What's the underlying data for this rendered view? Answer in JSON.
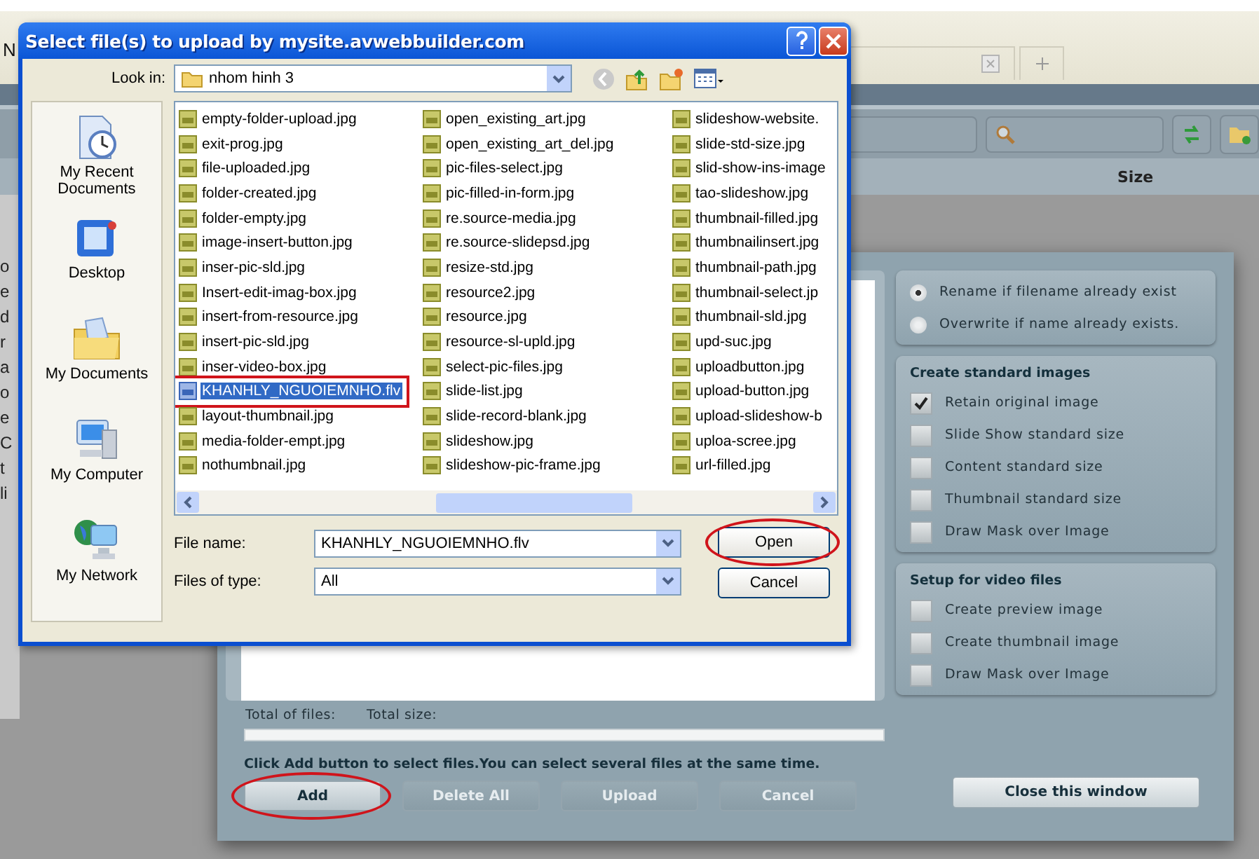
{
  "browser": {
    "fragment": "N"
  },
  "background_app": {
    "left_fragments": [
      "o",
      "e",
      "d",
      "r",
      "a",
      "o",
      "e",
      "C",
      "t",
      "li"
    ],
    "column_header": "Size"
  },
  "upload_panel": {
    "totals": [
      "Total of files:",
      "Total size:"
    ],
    "hint": "Click Add button to select files.You can select several files at the same time.",
    "buttons": [
      {
        "label": "Add",
        "disabled": false,
        "highlighted": true
      },
      {
        "label": "Delete All",
        "disabled": true,
        "highlighted": false
      },
      {
        "label": "Upload",
        "disabled": true,
        "highlighted": false
      },
      {
        "label": "Cancel",
        "disabled": true,
        "highlighted": false
      }
    ],
    "conflict_options": [
      {
        "label": "Rename if filename already exist",
        "selected": true
      },
      {
        "label": "Overwrite if name already exists.",
        "selected": false
      }
    ],
    "groups": [
      {
        "title": "Create standard images",
        "options": [
          {
            "label": "Retain original image",
            "checked": true
          },
          {
            "label": "Slide Show standard size",
            "checked": false
          },
          {
            "label": "Content standard size",
            "checked": false
          },
          {
            "label": "Thumbnail standard size",
            "checked": false
          },
          {
            "label": "Draw Mask over Image",
            "checked": false
          }
        ]
      },
      {
        "title": "Setup for video files",
        "options": [
          {
            "label": "Create preview image",
            "checked": false
          },
          {
            "label": "Create thumbnail image",
            "checked": false
          },
          {
            "label": "Draw Mask over Image",
            "checked": false
          }
        ]
      }
    ],
    "close_button": "Close this window"
  },
  "file_dialog": {
    "title": "Select file(s) to upload by mysite.avwebbuilder.com",
    "look_in_label": "Look in:",
    "folder": "nhom hinh 3",
    "places": [
      {
        "label": "My Recent Documents",
        "kind": "recent"
      },
      {
        "label": "Desktop",
        "kind": "desktop"
      },
      {
        "label": "My Documents",
        "kind": "documents"
      },
      {
        "label": "My Computer",
        "kind": "computer"
      },
      {
        "label": "My Network",
        "kind": "network"
      }
    ],
    "files": [
      {
        "name": "empty-folder-upload.jpg",
        "kind": "jpg",
        "selected": false
      },
      {
        "name": "exit-prog.jpg",
        "kind": "jpg",
        "selected": false
      },
      {
        "name": "file-uploaded.jpg",
        "kind": "jpg",
        "selected": false
      },
      {
        "name": "folder-created.jpg",
        "kind": "jpg",
        "selected": false
      },
      {
        "name": "folder-empty.jpg",
        "kind": "jpg",
        "selected": false
      },
      {
        "name": "image-insert-button.jpg",
        "kind": "jpg",
        "selected": false
      },
      {
        "name": "inser-pic-sld.jpg",
        "kind": "jpg",
        "selected": false
      },
      {
        "name": "Insert-edit-imag-box.jpg",
        "kind": "jpg",
        "selected": false
      },
      {
        "name": "insert-from-resource.jpg",
        "kind": "jpg",
        "selected": false
      },
      {
        "name": "insert-pic-sld.jpg",
        "kind": "jpg",
        "selected": false
      },
      {
        "name": "inser-video-box.jpg",
        "kind": "jpg",
        "selected": false
      },
      {
        "name": "KHANHLY_NGUOIEMNHO.flv",
        "kind": "flv",
        "selected": true
      },
      {
        "name": "layout-thumbnail.jpg",
        "kind": "jpg",
        "selected": false
      },
      {
        "name": "media-folder-empt.jpg",
        "kind": "jpg",
        "selected": false
      },
      {
        "name": "nothumbnail.jpg",
        "kind": "jpg",
        "selected": false
      },
      {
        "name": "open_existing_art.jpg",
        "kind": "jpg",
        "selected": false
      },
      {
        "name": "open_existing_art_del.jpg",
        "kind": "jpg",
        "selected": false
      },
      {
        "name": "pic-files-select.jpg",
        "kind": "jpg",
        "selected": false
      },
      {
        "name": "pic-filled-in-form.jpg",
        "kind": "jpg",
        "selected": false
      },
      {
        "name": "re.source-media.jpg",
        "kind": "jpg",
        "selected": false
      },
      {
        "name": "re.source-slidepsd.jpg",
        "kind": "jpg",
        "selected": false
      },
      {
        "name": "resize-std.jpg",
        "kind": "jpg",
        "selected": false
      },
      {
        "name": "resource2.jpg",
        "kind": "jpg",
        "selected": false
      },
      {
        "name": "resource.jpg",
        "kind": "jpg",
        "selected": false
      },
      {
        "name": "resource-sl-upld.jpg",
        "kind": "jpg",
        "selected": false
      },
      {
        "name": "select-pic-files.jpg",
        "kind": "jpg",
        "selected": false
      },
      {
        "name": "slide-list.jpg",
        "kind": "jpg",
        "selected": false
      },
      {
        "name": "slide-record-blank.jpg",
        "kind": "jpg",
        "selected": false
      },
      {
        "name": "slideshow.jpg",
        "kind": "jpg",
        "selected": false
      },
      {
        "name": "slideshow-pic-frame.jpg",
        "kind": "jpg",
        "selected": false
      },
      {
        "name": "slideshow-website.",
        "kind": "jpg",
        "selected": false
      },
      {
        "name": "slide-std-size.jpg",
        "kind": "jpg",
        "selected": false
      },
      {
        "name": "slid-show-ins-image",
        "kind": "jpg",
        "selected": false
      },
      {
        "name": "tao-slideshow.jpg",
        "kind": "jpg",
        "selected": false
      },
      {
        "name": "thumbnail-filled.jpg",
        "kind": "jpg",
        "selected": false
      },
      {
        "name": "thumbnailinsert.jpg",
        "kind": "jpg",
        "selected": false
      },
      {
        "name": "thumbnail-path.jpg",
        "kind": "jpg",
        "selected": false
      },
      {
        "name": "thumbnail-select.jp",
        "kind": "jpg",
        "selected": false
      },
      {
        "name": "thumbnail-sld.jpg",
        "kind": "jpg",
        "selected": false
      },
      {
        "name": "upd-suc.jpg",
        "kind": "jpg",
        "selected": false
      },
      {
        "name": "uploadbutton.jpg",
        "kind": "jpg",
        "selected": false
      },
      {
        "name": "upload-button.jpg",
        "kind": "jpg",
        "selected": false
      },
      {
        "name": "upload-slideshow-b",
        "kind": "jpg",
        "selected": false
      },
      {
        "name": "uploa-scree.jpg",
        "kind": "jpg",
        "selected": false
      },
      {
        "name": "url-filled.jpg",
        "kind": "jpg",
        "selected": false
      }
    ],
    "file_name_label": "File name:",
    "file_name": "KHANHLY_NGUOIEMNHO.flv",
    "file_type_label": "Files of type:",
    "file_type": "All",
    "buttons": [
      {
        "label": "Open",
        "highlighted": true
      },
      {
        "label": "Cancel",
        "highlighted": false
      }
    ]
  }
}
